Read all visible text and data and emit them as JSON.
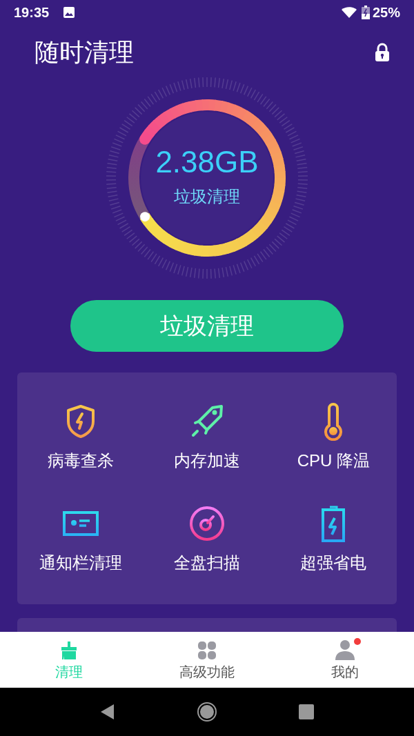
{
  "status_bar": {
    "time": "19:35",
    "battery": "25%"
  },
  "header": {
    "title": "随时清理"
  },
  "gauge": {
    "value": "2.38GB",
    "label": "垃圾清理"
  },
  "primary_button": {
    "label": "垃圾清理"
  },
  "tools": [
    {
      "label": "病毒查杀"
    },
    {
      "label": "内存加速"
    },
    {
      "label": "CPU 降温"
    },
    {
      "label": "通知栏清理"
    },
    {
      "label": "全盘扫描"
    },
    {
      "label": "超强省电"
    }
  ],
  "bottom_nav": [
    {
      "label": "清理",
      "selected": true,
      "badge": false
    },
    {
      "label": "高级功能",
      "selected": false,
      "badge": false
    },
    {
      "label": "我的",
      "selected": false,
      "badge": true
    }
  ]
}
